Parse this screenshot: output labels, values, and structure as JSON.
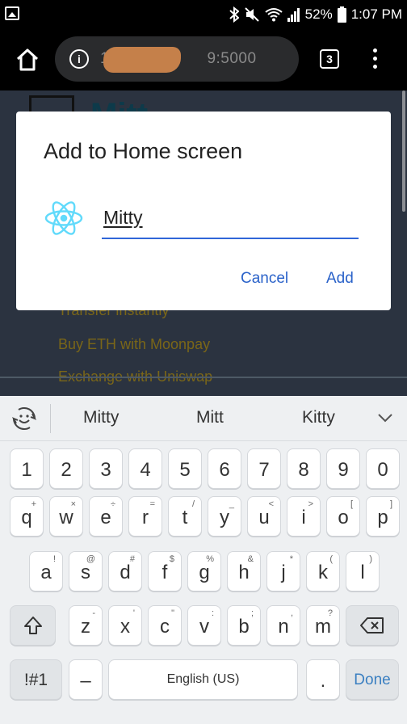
{
  "status_bar": {
    "battery": "52%",
    "time": "1:07 PM"
  },
  "browser": {
    "url_prefix": "1",
    "url_suffix": "9:5000",
    "tab_count": "3"
  },
  "page": {
    "logo_text": "Mitt",
    "links": [
      "Transfer instantly",
      "Buy ETH with Moonpay",
      "Exchange with Uniswap"
    ]
  },
  "dialog": {
    "title": "Add to Home screen",
    "app_name_value": "Mitty",
    "cancel_label": "Cancel",
    "add_label": "Add",
    "icon_color": "#61dafb",
    "accent_color": "#2a62c9"
  },
  "keyboard": {
    "suggestions": [
      "Mitty",
      "Mitt",
      "Kitty"
    ],
    "number_row": [
      "1",
      "2",
      "3",
      "4",
      "5",
      "6",
      "7",
      "8",
      "9",
      "0"
    ],
    "row1": [
      {
        "key": "q",
        "sub": "+"
      },
      {
        "key": "w",
        "sub": "×"
      },
      {
        "key": "e",
        "sub": "÷"
      },
      {
        "key": "r",
        "sub": "="
      },
      {
        "key": "t",
        "sub": "/"
      },
      {
        "key": "y",
        "sub": "_"
      },
      {
        "key": "u",
        "sub": "<"
      },
      {
        "key": "i",
        "sub": ">"
      },
      {
        "key": "o",
        "sub": "["
      },
      {
        "key": "p",
        "sub": "]"
      }
    ],
    "row2": [
      {
        "key": "a",
        "sub": "!"
      },
      {
        "key": "s",
        "sub": "@"
      },
      {
        "key": "d",
        "sub": "#"
      },
      {
        "key": "f",
        "sub": "$"
      },
      {
        "key": "g",
        "sub": "%"
      },
      {
        "key": "h",
        "sub": "&"
      },
      {
        "key": "j",
        "sub": "*"
      },
      {
        "key": "k",
        "sub": "("
      },
      {
        "key": "l",
        "sub": ")"
      }
    ],
    "row3": [
      {
        "key": "z",
        "sub": "-"
      },
      {
        "key": "x",
        "sub": "'"
      },
      {
        "key": "c",
        "sub": "\""
      },
      {
        "key": "v",
        "sub": ":"
      },
      {
        "key": "b",
        "sub": ";"
      },
      {
        "key": "n",
        "sub": ","
      },
      {
        "key": "m",
        "sub": "?"
      }
    ],
    "symbols_label": "!#1",
    "dash_label": "–",
    "space_label": "English (US)",
    "period_label": ".",
    "done_label": "Done"
  }
}
